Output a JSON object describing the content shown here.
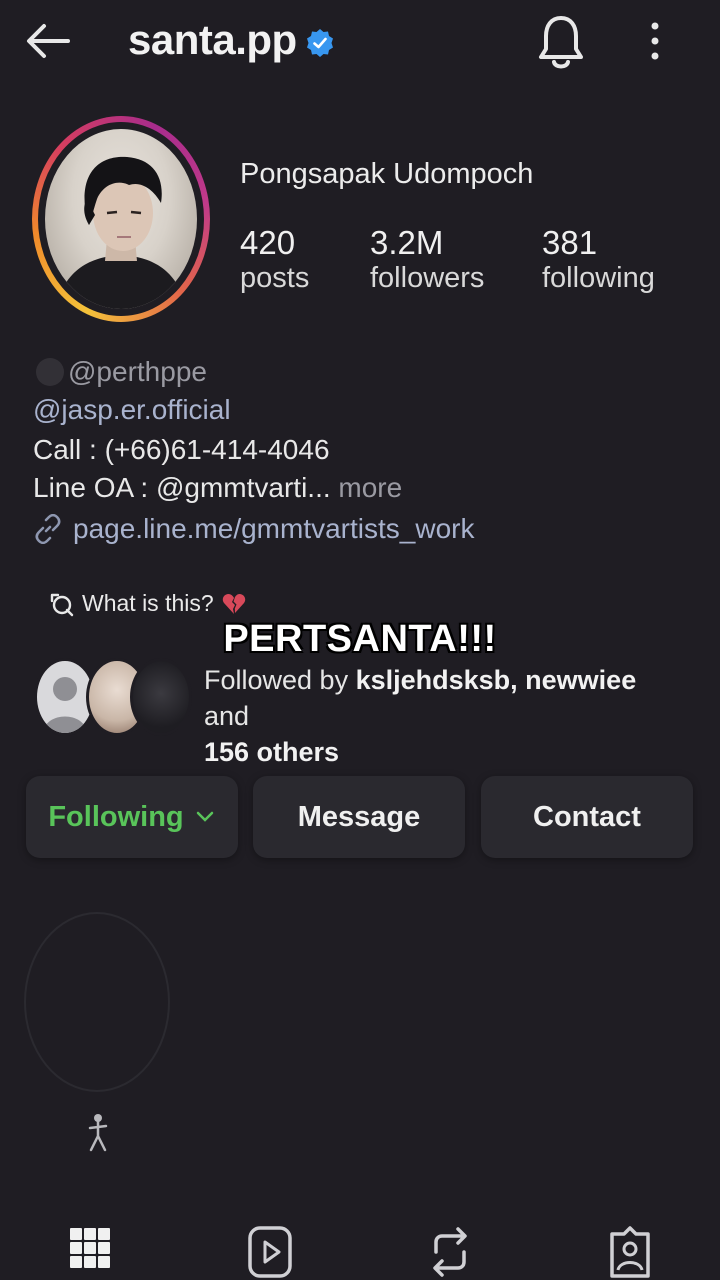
{
  "header": {
    "username": "santa.pp",
    "verified": true,
    "icons": [
      "back-arrow-icon",
      "verified-badge-icon",
      "bell-icon",
      "more-vertical-icon"
    ]
  },
  "profile": {
    "full_name": "Pongsapak Udompoch",
    "stats": [
      {
        "value": "420",
        "label": "posts"
      },
      {
        "value": "3.2M",
        "label": "followers"
      },
      {
        "value": "381",
        "label": "following"
      }
    ]
  },
  "bio": {
    "threads_handle": "@perthppe",
    "mention": "@jasp.er.official",
    "call": "Call : (+66)61-414-4046",
    "line_oa": "Line OA : @gmmtvarti...",
    "more_label": "more",
    "link": "page.line.me/gmmtvartists_work"
  },
  "what_is_this": "What is this?",
  "overlay_caption": "PERTSANTA!!!",
  "followed_by": {
    "prefix": "Followed by ",
    "names": "ksljehdsksb, newwiee",
    "and": " and",
    "others": "156 others"
  },
  "actions": {
    "following": "Following",
    "message": "Message",
    "contact": "Contact"
  },
  "tabs": [
    "grid-icon",
    "reels-icon",
    "reposts-icon",
    "tagged-icon"
  ],
  "colors": {
    "background": "#1f1d23",
    "button_bg": "#2a292f",
    "following_green": "#59c45a",
    "verified_blue": "#3897f0",
    "link": "#a9b3ce"
  }
}
